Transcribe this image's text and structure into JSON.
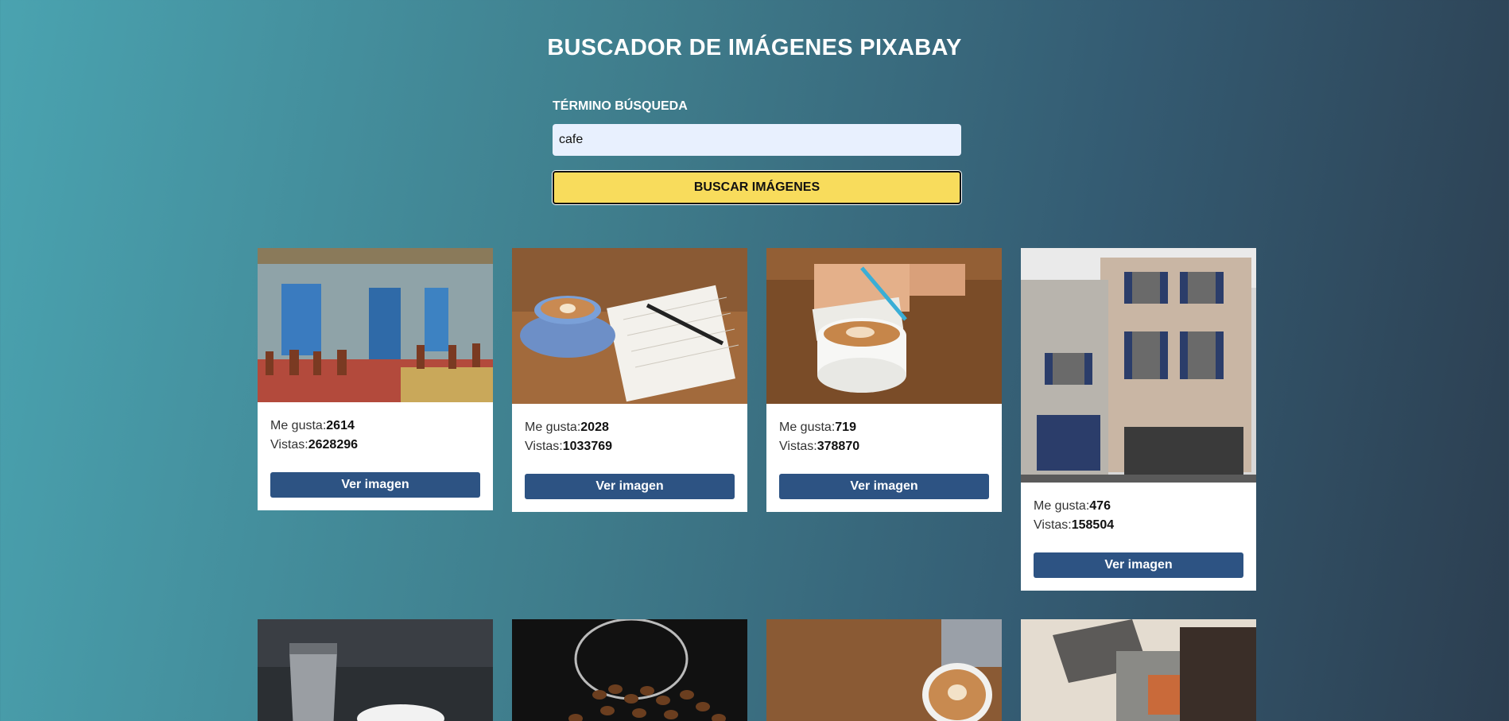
{
  "header": {
    "title": "BUSCADOR DE IMÁGENES PIXABAY"
  },
  "search": {
    "label": "TÉRMINO BÚSQUEDA",
    "value": "cafe",
    "button_label": "BUSCAR IMÁGENES"
  },
  "results": [
    {
      "likes_label": "Me gusta:",
      "likes": "2614",
      "views_label": "Vistas:",
      "views": "2628296",
      "button": "Ver imagen"
    },
    {
      "likes_label": "Me gusta:",
      "likes": "2028",
      "views_label": "Vistas:",
      "views": "1033769",
      "button": "Ver imagen"
    },
    {
      "likes_label": "Me gusta:",
      "likes": "719",
      "views_label": "Vistas:",
      "views": "378870",
      "button": "Ver imagen"
    },
    {
      "likes_label": "Me gusta:",
      "likes": "476",
      "views_label": "Vistas:",
      "views": "158504",
      "button": "Ver imagen"
    }
  ],
  "colors": {
    "accent_button": "#f8dc5c",
    "card_button": "#2d5383",
    "input_bg": "#e8f0fe"
  }
}
